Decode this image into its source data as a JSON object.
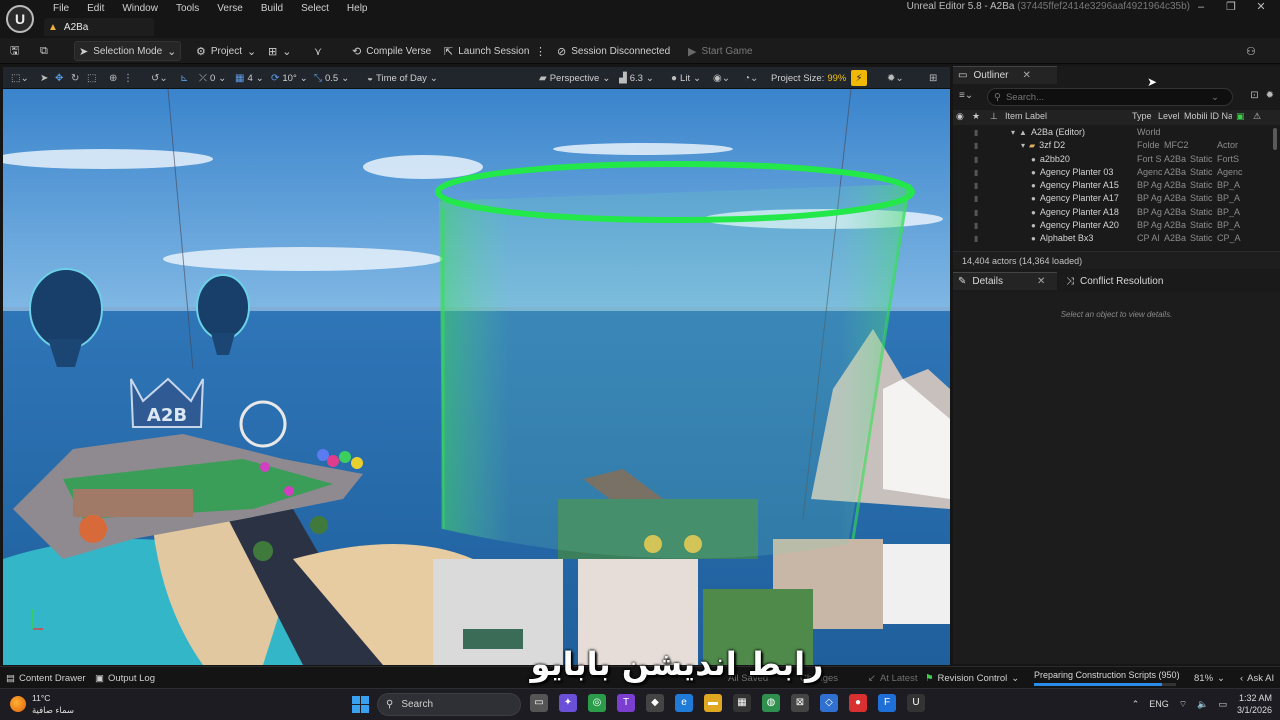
{
  "title_bar": {
    "menu": [
      "File",
      "Edit",
      "Window",
      "Tools",
      "Verse",
      "Build",
      "Select",
      "Help"
    ],
    "map_tab": "A2Ba",
    "window_title": "Unreal Editor 5.8 - A2Ba",
    "window_hash": "(37445ffef2414e3296aaf4921964c35b)",
    "controls": [
      "–",
      "❐",
      "✕"
    ]
  },
  "toolbar": {
    "selection_mode": "Selection Mode",
    "project": "Project",
    "compile_verse": "Compile Verse",
    "launch_session": "Launch Session",
    "session_disconnected": "Session Disconnected",
    "start_game": "Start Game"
  },
  "viewport": {
    "snap_rotate": "0",
    "grid_value": "4",
    "rotation_snap": "10°",
    "scale_snap": "0.5",
    "time_of_day": "Time of Day",
    "perspective": "Perspective",
    "camera_speed": "6.3",
    "view_mode": "Lit",
    "project_size_label": "Project Size:",
    "project_size_value": "99%"
  },
  "outliner": {
    "tab_label": "Outliner",
    "search_placeholder": "Search...",
    "columns": {
      "item_label": "Item Label",
      "type": "Type",
      "level": "Level",
      "mobility": "Mobili",
      "id_name": "ID Nai"
    },
    "rows": [
      {
        "label": "A2Ba (Editor)",
        "type": "World",
        "level": "",
        "mobility": "",
        "id": "",
        "indent": 1,
        "icon": "world"
      },
      {
        "label": "3zf D2",
        "type": "Folde",
        "level": "MFC2",
        "mobility": "",
        "id": "Actor",
        "indent": 2,
        "icon": "folder"
      },
      {
        "label": "a2bb20",
        "type": "Fort S",
        "level": "A2Ba",
        "mobility": "Static",
        "id": "FortS",
        "indent": 3,
        "icon": "actor"
      },
      {
        "label": "Agency Planter 03",
        "type": "Agenc",
        "level": "A2Ba",
        "mobility": "Static",
        "id": "Agenc",
        "indent": 3,
        "icon": "actor"
      },
      {
        "label": "Agency Planter A15",
        "type": "BP Ag",
        "level": "A2Ba",
        "mobility": "Static",
        "id": "BP_A",
        "indent": 3,
        "icon": "actor"
      },
      {
        "label": "Agency Planter A17",
        "type": "BP Ag",
        "level": "A2Ba",
        "mobility": "Static",
        "id": "BP_A",
        "indent": 3,
        "icon": "actor"
      },
      {
        "label": "Agency Planter A18",
        "type": "BP Ag",
        "level": "A2Ba",
        "mobility": "Static",
        "id": "BP_A",
        "indent": 3,
        "icon": "actor"
      },
      {
        "label": "Agency Planter A20",
        "type": "BP Ag",
        "level": "A2Ba",
        "mobility": "Static",
        "id": "BP_A",
        "indent": 3,
        "icon": "actor"
      },
      {
        "label": "Alphabet Bx3",
        "type": "CP Al",
        "level": "A2Ba",
        "mobility": "Static",
        "id": "CP_A",
        "indent": 3,
        "icon": "actor"
      }
    ],
    "actor_count": "14,404 actors (14,364 loaded)"
  },
  "details": {
    "tab_label": "Details",
    "conflict_tab": "Conflict Resolution",
    "empty_text": "Select an object to view details."
  },
  "statusbar": {
    "content_drawer": "Content Drawer",
    "output_log": "Output Log",
    "all_saved": "All Saved",
    "changes": "Changes",
    "at_latest": "At Latest",
    "revision_control": "Revision Control",
    "progress_label": "Preparing Construction Scripts (950)",
    "progress_fraction": 0.9,
    "progress_percent": "81%",
    "ask_ai": "Ask AI"
  },
  "watermark": "رابط انديشن بابايو",
  "taskbar": {
    "temperature": "11°C",
    "weather_desc": "سماء صافية",
    "search_label": "Search",
    "language": "ENG",
    "time": "1:32 AM",
    "date": "3/1/2026"
  }
}
